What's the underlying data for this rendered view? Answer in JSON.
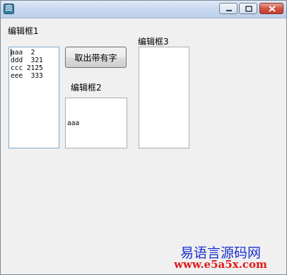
{
  "labels": {
    "edit1": "编辑框1",
    "edit2": "编辑框2",
    "edit3": "编辑框3"
  },
  "buttons": {
    "extract": "取出带有字"
  },
  "edit_boxes": {
    "edit1": "aaa  2\nddd  321\nccc 2125\neee  333",
    "edit2": "aaa",
    "edit3": ""
  },
  "watermark": {
    "site_name": "易语言源码网",
    "url": "www.e5a5x.com"
  },
  "colors": {
    "watermark_blue": "#1c2fd0",
    "watermark_red": "#e01a1a",
    "close_button_red": "#c2402f"
  }
}
